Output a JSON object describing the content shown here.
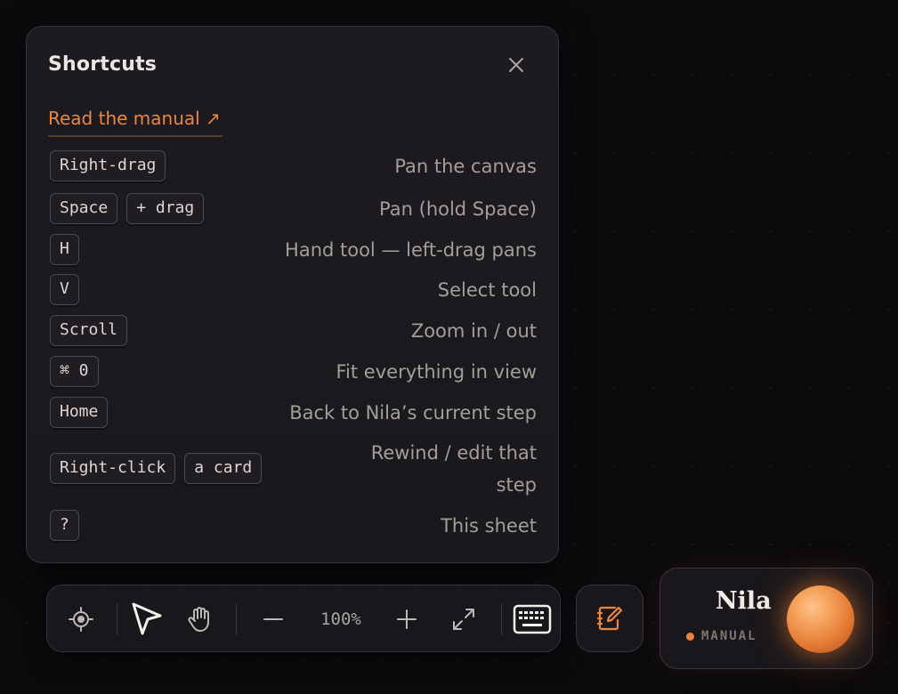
{
  "panel": {
    "title": "Shortcuts",
    "close_icon": "close-icon",
    "manual_link": "Read the manual ↗"
  },
  "shortcuts": [
    {
      "keys": [
        "Right-drag"
      ],
      "description": "Pan the canvas"
    },
    {
      "keys": [
        "Space",
        "+ drag"
      ],
      "description": "Pan (hold Space)"
    },
    {
      "keys": [
        "H"
      ],
      "description": "Hand tool — left-drag pans"
    },
    {
      "keys": [
        "V"
      ],
      "description": "Select tool"
    },
    {
      "keys": [
        "Scroll"
      ],
      "description": "Zoom in / out"
    },
    {
      "keys": [
        "⌘ 0"
      ],
      "description": "Fit everything in view"
    },
    {
      "keys": [
        "Home"
      ],
      "description": "Back to Nila’s current step"
    },
    {
      "keys": [
        "Right-click",
        "a card"
      ],
      "description": "Rewind / edit that step"
    },
    {
      "keys": [
        "?"
      ],
      "description": "This sheet"
    }
  ],
  "toolbar": {
    "zoom_level": "100%",
    "icons": [
      "locate-icon",
      "select-pointer-icon",
      "hand-tool-icon",
      "zoom-out-icon",
      "zoom-in-icon",
      "fit-view-icon",
      "keyboard-icon"
    ]
  },
  "notes_button": {
    "icon": "notebook-edit-icon"
  },
  "agent": {
    "name": "Nila",
    "mode": "MANUAL",
    "accent": "#e8843d"
  },
  "colors": {
    "accent": "#e8873f",
    "panel_bg": "#1c1a1e",
    "page_bg": "#0b0a0d"
  }
}
